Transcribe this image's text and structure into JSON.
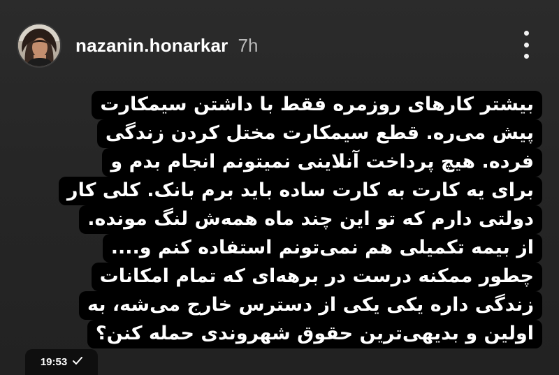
{
  "header": {
    "username": "nazanin.honarkar",
    "time_ago": "7h",
    "more_icon": "more-vertical-icon",
    "avatar_icon": "profile-photo"
  },
  "story_text": {
    "lines": [
      "بیشتر کارهای روزمره فقط با داشتن سیمکارت",
      "پیش می‌ره. قطع سیمکارت مختل کردن زندگی",
      "فرده. هیچ پرداخت آنلاینی نمیتونم انجام بدم و",
      "برای یه کارت به کارت ساده باید برم بانک. کلی کار",
      "دولتی دارم که تو این چند ماه همه‌ش لنگ مونده.",
      "از بیمه تکمیلی هم نمی‌تونم استفاده کنم و....",
      "چطور ممکنه درست در برهه‌ای که تمام امکانات",
      "زندگی داره یکی یکی از دسترس خارج می‌شه، به",
      "اولین و بدیهی‌ترین حقوق شهروندی حمله کنن؟"
    ]
  },
  "message_meta": {
    "timestamp": "19:53",
    "status_icon": "sent-check-icon"
  },
  "colors": {
    "background": "#272727",
    "text_background": "#000000",
    "text": "#ffffff",
    "time_ago": "#b9b9b9"
  }
}
